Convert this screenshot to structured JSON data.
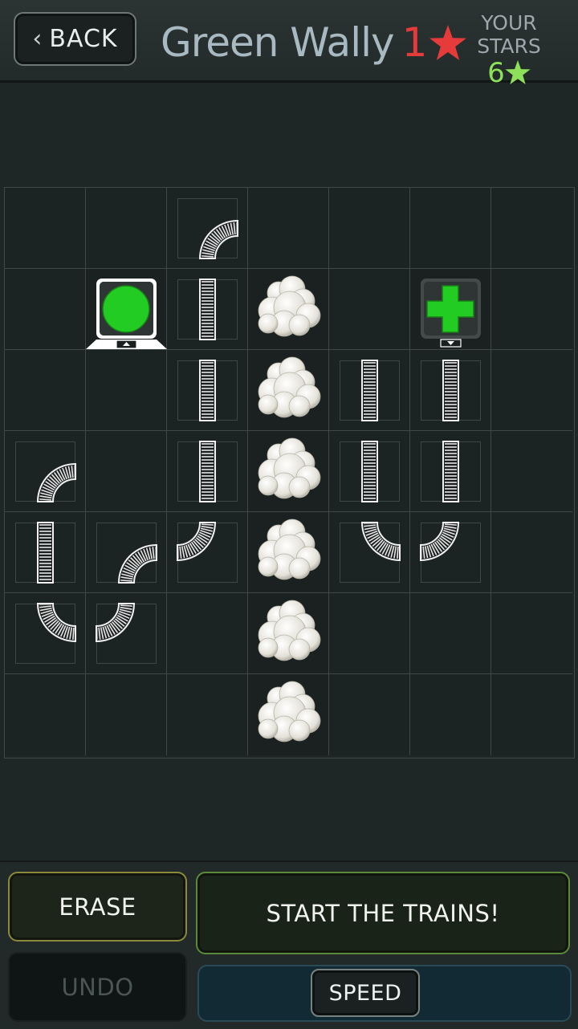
{
  "header": {
    "back_label": "BACK",
    "level_name": "Green Wally",
    "level_stars": "1",
    "your_stars_label": "YOUR STARS",
    "your_stars_value": "6"
  },
  "board": {
    "columns": 7,
    "rows": 7,
    "tiles": [
      {
        "row": 0,
        "col": 2,
        "type": "track-curve",
        "corner": "bottom-right"
      },
      {
        "row": 1,
        "col": 1,
        "type": "station-start",
        "color": "#22cc22",
        "shape": "circle"
      },
      {
        "row": 1,
        "col": 2,
        "type": "track-straight"
      },
      {
        "row": 1,
        "col": 3,
        "type": "rock"
      },
      {
        "row": 1,
        "col": 5,
        "type": "station-goal",
        "color": "#22cc22",
        "shape": "plus"
      },
      {
        "row": 2,
        "col": 2,
        "type": "track-straight"
      },
      {
        "row": 2,
        "col": 3,
        "type": "rock"
      },
      {
        "row": 2,
        "col": 4,
        "type": "track-straight"
      },
      {
        "row": 2,
        "col": 5,
        "type": "track-straight"
      },
      {
        "row": 3,
        "col": 0,
        "type": "track-curve",
        "corner": "bottom-right"
      },
      {
        "row": 3,
        "col": 2,
        "type": "track-straight"
      },
      {
        "row": 3,
        "col": 3,
        "type": "rock"
      },
      {
        "row": 3,
        "col": 4,
        "type": "track-straight"
      },
      {
        "row": 3,
        "col": 5,
        "type": "track-straight"
      },
      {
        "row": 4,
        "col": 0,
        "type": "track-straight"
      },
      {
        "row": 4,
        "col": 1,
        "type": "track-curve",
        "corner": "bottom-right"
      },
      {
        "row": 4,
        "col": 2,
        "type": "track-curve",
        "corner": "top-left"
      },
      {
        "row": 4,
        "col": 3,
        "type": "rock"
      },
      {
        "row": 4,
        "col": 4,
        "type": "track-curve",
        "corner": "top-right"
      },
      {
        "row": 4,
        "col": 5,
        "type": "track-curve",
        "corner": "top-left"
      },
      {
        "row": 5,
        "col": 0,
        "type": "track-curve",
        "corner": "top-right"
      },
      {
        "row": 5,
        "col": 1,
        "type": "track-curve",
        "corner": "top-left"
      },
      {
        "row": 5,
        "col": 3,
        "type": "rock"
      },
      {
        "row": 6,
        "col": 3,
        "type": "rock"
      }
    ]
  },
  "controls": {
    "erase_label": "ERASE",
    "start_label": "START THE TRAINS!",
    "undo_label": "UNDO",
    "speed_label": "SPEED"
  },
  "colors": {
    "background": "#1f2726",
    "level_star": "#e53b3b",
    "your_stars": "#8ee05a",
    "station_green": "#22cc22"
  }
}
